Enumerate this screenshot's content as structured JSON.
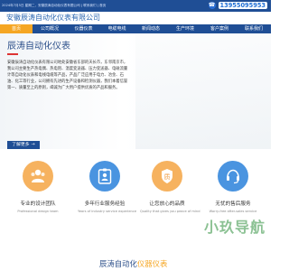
{
  "topbar": {
    "text": "2024年7月5日 星期二，安徽辰涛自动化仪表有限公司 | 联系我们 | 首页",
    "phone": "13955095953"
  },
  "header": {
    "logo": "安徽辰涛自动化仪表有限公司"
  },
  "nav": {
    "items": [
      {
        "label": "首页",
        "active": true
      },
      {
        "label": "公司概况",
        "active": false
      },
      {
        "label": "仪器仪表",
        "active": false
      },
      {
        "label": "电缆电线",
        "active": false
      },
      {
        "label": "新闻动态",
        "active": false
      },
      {
        "label": "生产环境",
        "active": false
      },
      {
        "label": "客户案例",
        "active": false
      },
      {
        "label": "联系我们",
        "active": false
      }
    ]
  },
  "hero": {
    "title": "辰涛自动化仪表",
    "description": "安徽辰涛自动化仪表有限公司地处安徽省东部的天长市，东邻南京市，我公司主要生产热电偶、热电阻、温度变送器、压力变送器、电磁流量计等自动化仪表和电线电缆等产品，产品广泛应用于电力、冶金、石油、化工等行业，公司拥有先进的生产设备和检测仪器，我们本着信誉第一、质量至上的原则，竭诚为广大用户提供优质的产品和服务。",
    "more_label": "了解更多",
    "more_arrow": "→"
  },
  "features": [
    {
      "title": "专业的设计团队",
      "subtitle": "Professional design team",
      "icon": "team-icon",
      "color": "#f0a04a"
    },
    {
      "title": "多年行业服务经验",
      "subtitle": "Years of industry service experience",
      "icon": "id-card-icon",
      "color": "#3a86d6"
    },
    {
      "title": "让您放心的品质",
      "subtitle": "Quality that gives you peace of mind",
      "icon": "quality-icon",
      "color": "#f0a04a"
    },
    {
      "title": "无忧的售后服务",
      "subtitle": "Worry-free after-sales service",
      "icon": "service-icon",
      "color": "#3a86d6"
    }
  ],
  "watermark": "小玖导航",
  "section": {
    "title_main": "辰涛自动化",
    "title_accent": "仪器仪表"
  }
}
